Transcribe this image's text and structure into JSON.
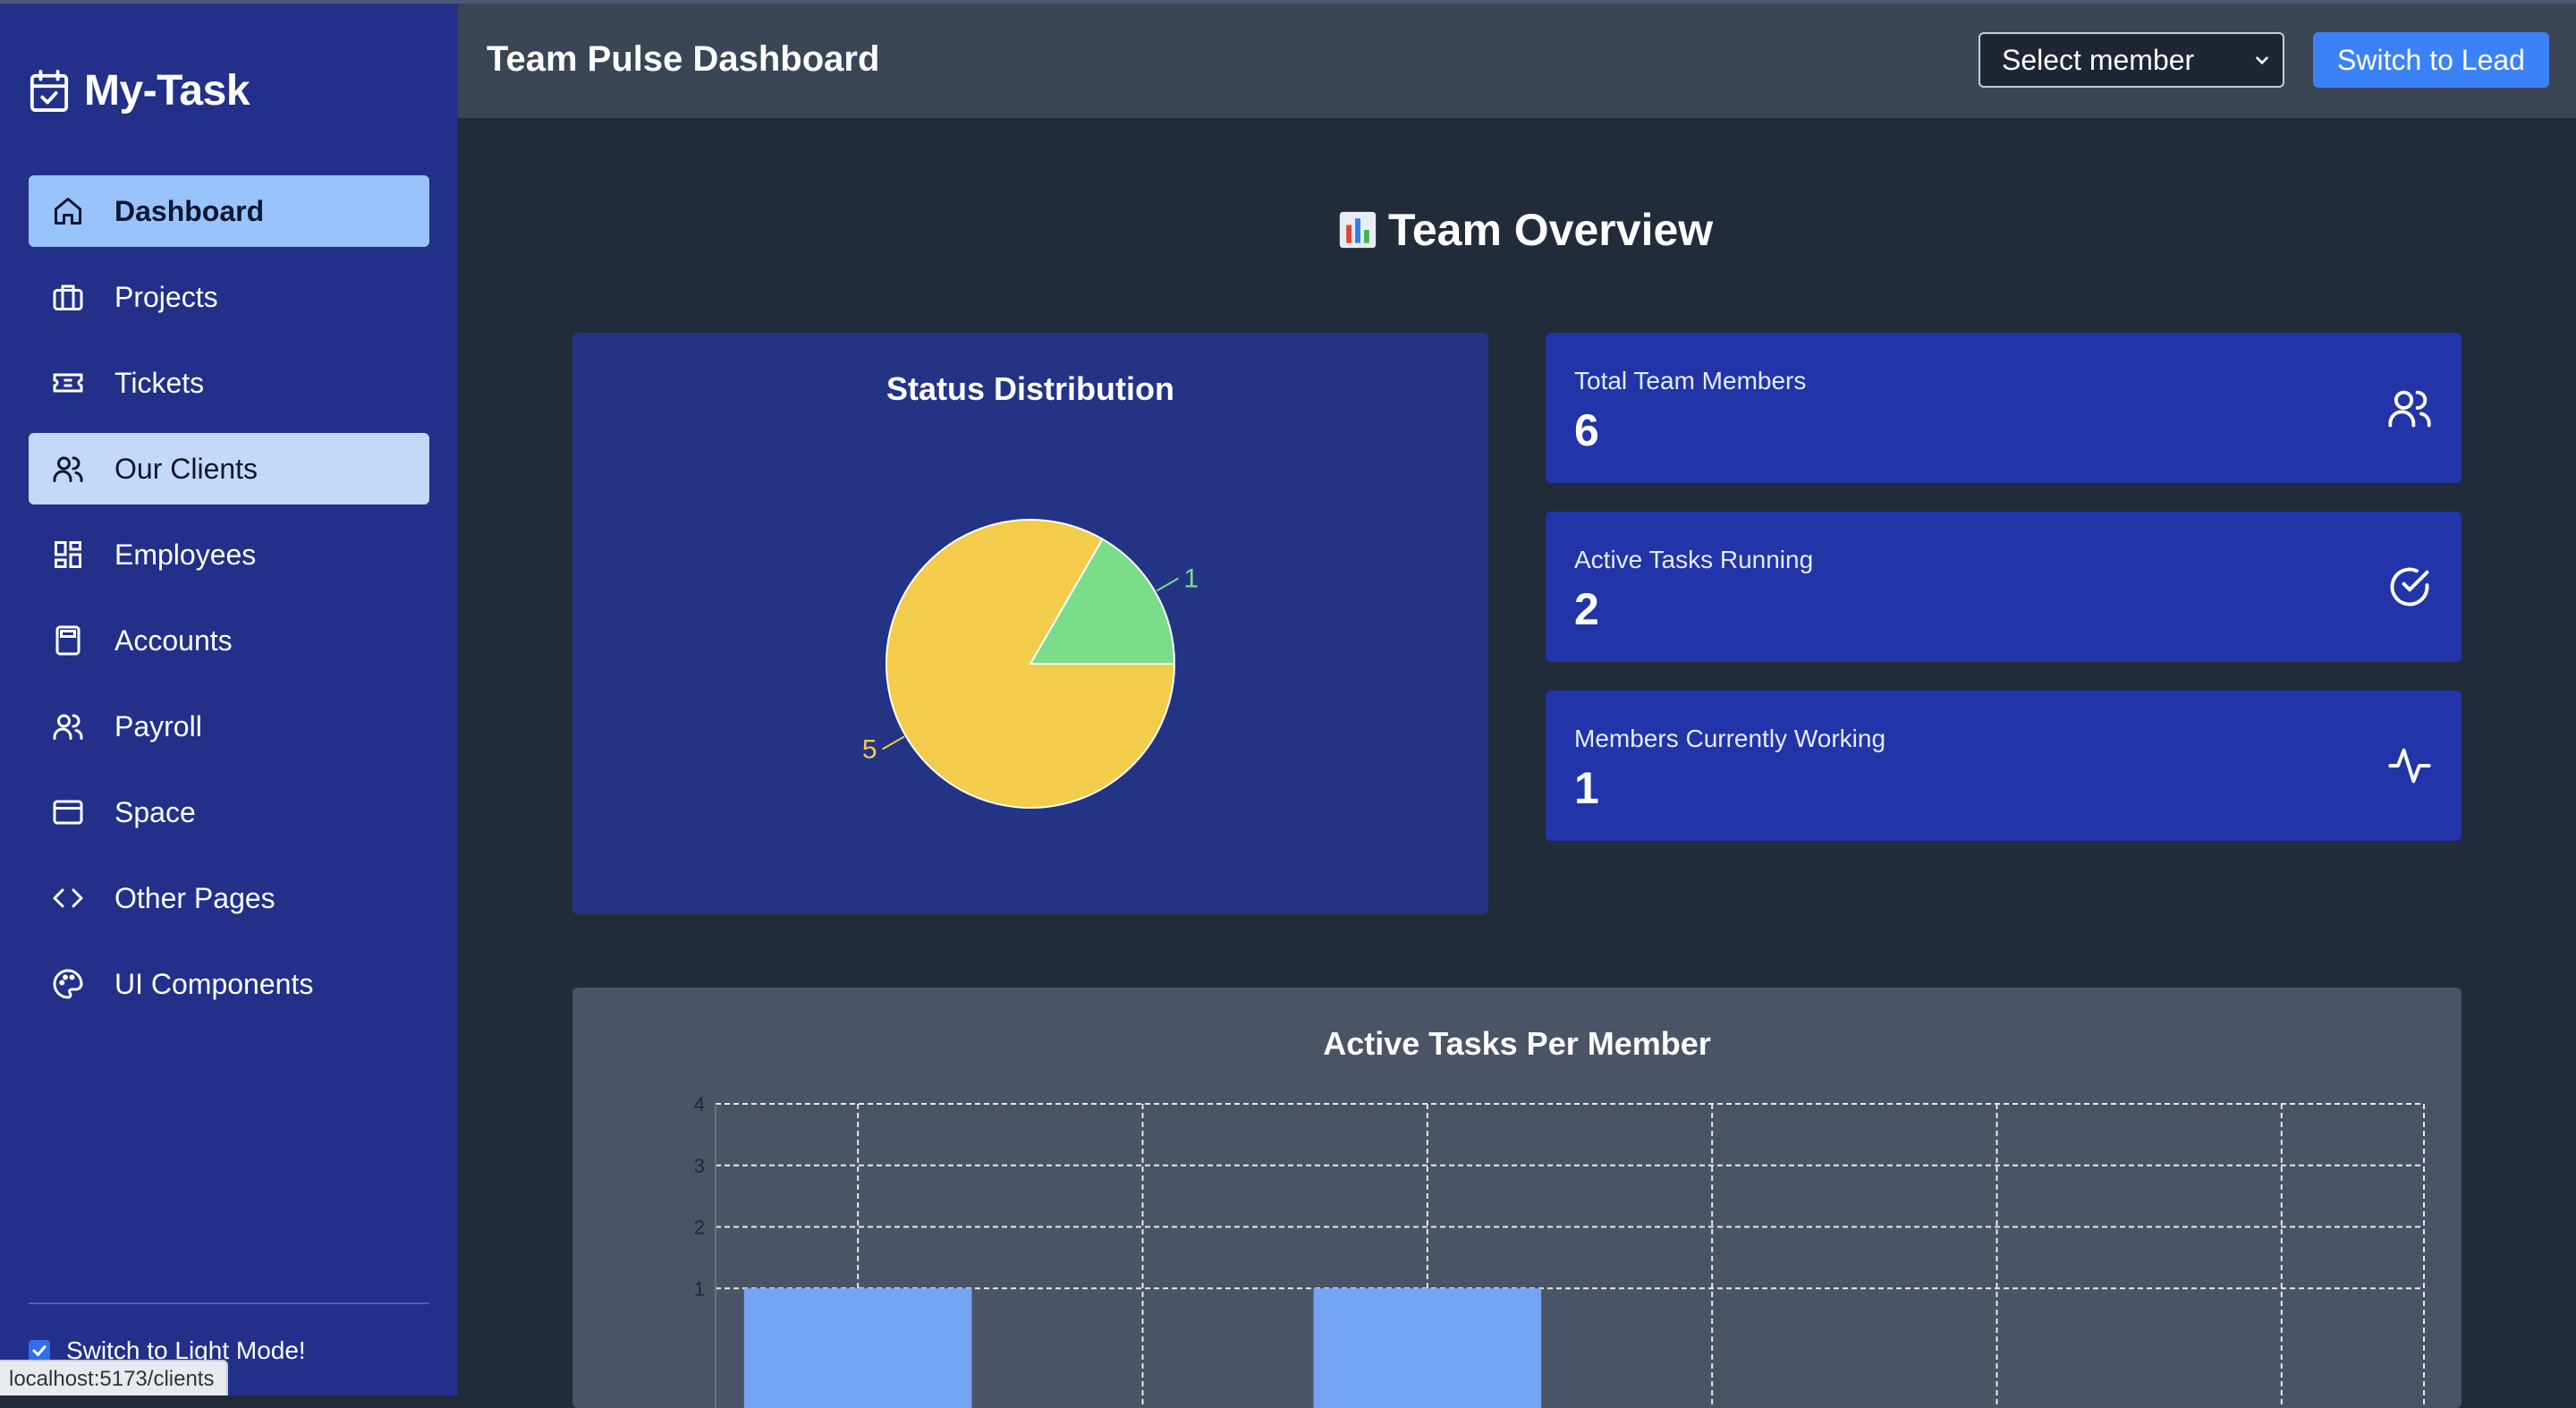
{
  "brand": {
    "name": "My-Task",
    "icon": "calendar-check-icon"
  },
  "sidebar": {
    "items": [
      {
        "label": "Dashboard",
        "icon": "home-icon",
        "state": "active"
      },
      {
        "label": "Projects",
        "icon": "briefcase-icon",
        "state": ""
      },
      {
        "label": "Tickets",
        "icon": "ticket-icon",
        "state": ""
      },
      {
        "label": "Our Clients",
        "icon": "users-icon",
        "state": "hover"
      },
      {
        "label": "Employees",
        "icon": "grid-icon",
        "state": ""
      },
      {
        "label": "Accounts",
        "icon": "calculator-icon",
        "state": ""
      },
      {
        "label": "Payroll",
        "icon": "user-group-icon",
        "state": ""
      },
      {
        "label": "Space",
        "icon": "window-icon",
        "state": ""
      },
      {
        "label": "Other Pages",
        "icon": "code-icon",
        "state": ""
      },
      {
        "label": "UI Components",
        "icon": "palette-icon",
        "state": ""
      }
    ],
    "light_mode_label": "Switch to Light Mode!",
    "light_mode_checked": true
  },
  "status_url": "localhost:5173/clients",
  "header": {
    "title": "Team Pulse Dashboard",
    "member_select": "Select member",
    "switch_button": "Switch to Lead"
  },
  "overview": {
    "title": "Team Overview",
    "icon": "bar-chart-emoji-icon"
  },
  "stats": [
    {
      "label": "Total Team Members",
      "value": "6",
      "icon": "users-icon"
    },
    {
      "label": "Active Tasks Running",
      "value": "2",
      "icon": "check-circle-icon"
    },
    {
      "label": "Members Currently Working",
      "value": "1",
      "icon": "activity-icon"
    }
  ],
  "colors": {
    "sidebar_bg": "#223089",
    "active_nav": "#98c3fb",
    "stat_card": "#2134a8",
    "pie_yellow": "#f2cc4a",
    "pie_green": "#79dd8a",
    "bar_blue": "#74a4f4",
    "button_blue": "#3b82f6"
  },
  "chart_data": [
    {
      "type": "pie",
      "title": "Status Distribution",
      "series": [
        {
          "value": 5,
          "label": "5",
          "color": "#f2cc4a"
        },
        {
          "value": 1,
          "label": "1",
          "color": "#79dd8a"
        }
      ]
    },
    {
      "type": "bar",
      "title": "Active Tasks Per Member",
      "categories": [
        "",
        "",
        "",
        "",
        "",
        ""
      ],
      "values": [
        1,
        0,
        1,
        0,
        0,
        0
      ],
      "ylim": [
        0,
        4
      ],
      "yticks": [
        "1",
        "2",
        "3",
        "4"
      ],
      "grid": true
    }
  ]
}
